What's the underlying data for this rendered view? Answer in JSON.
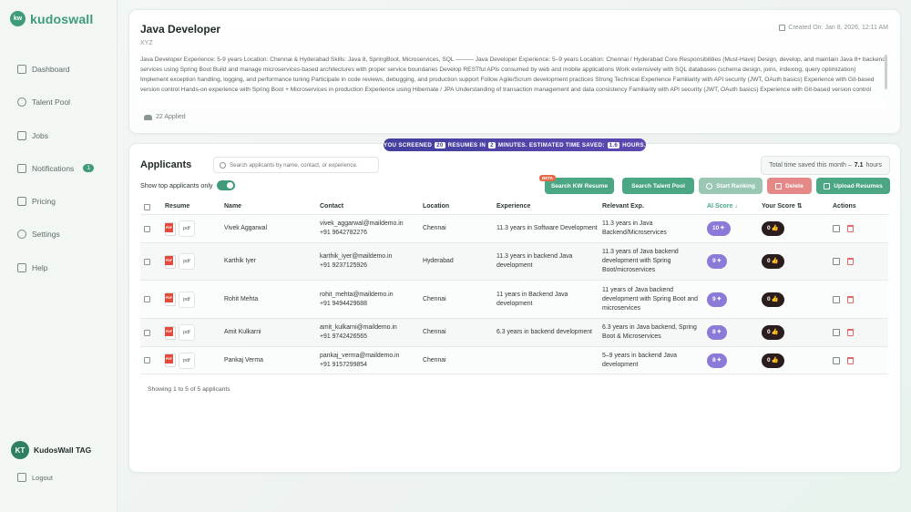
{
  "brand": {
    "mark": "kw",
    "name": "kudoswall"
  },
  "sidebar": {
    "items": [
      {
        "label": "Dashboard",
        "icon": "dashboard-icon"
      },
      {
        "label": "Talent Pool",
        "icon": "talent-pool-icon"
      },
      {
        "label": "Jobs",
        "icon": "jobs-icon"
      },
      {
        "label": "Notifications",
        "icon": "bell-icon",
        "badge": "1"
      },
      {
        "label": "Pricing",
        "icon": "pricing-icon"
      },
      {
        "label": "Settings",
        "icon": "gear-icon"
      },
      {
        "label": "Help",
        "icon": "help-icon"
      }
    ],
    "user": {
      "initials": "KT",
      "name": "KudosWall TAG"
    },
    "logout": "Logout"
  },
  "job": {
    "title": "Java Developer",
    "company": "XYZ",
    "created": "Created On: Jan 8, 2026, 12:11 AM",
    "description": "Java Developer Experience: 5-9 years Location: Chennai & Hyderabad Skills: Java 8, SpringBoot, Microservices, SQL ——— Java Developer Experience: 5–9 years Location: Chennai / Hyderabad Core Responsibilities (Must-Have) Design, develop, and maintain Java 8+ backend services using Spring Boot Build and manage microservices-based architectures with proper service boundaries Develop RESTful APIs consumed by web and mobile applications Work extensively with SQL databases (schema design, joins, indexing, query optimization) Implement exception handling, logging, and performance tuning Participate in code reviews, debugging, and production support Follow Agile/Scrum development practices Strong Technical Experience Familiarity with API security (JWT, OAuth basics) Experience with Git-based version control Hands-on experience with Spring Boot + Microservices in production Experience using Hibernate / JPA Understanding of transaction management and data consistency Familiarity with API security (JWT, OAuth basics) Experience with Git-based version control",
    "applied": "22 Applied"
  },
  "banner": {
    "prefix": "YOU SCREENED",
    "resumes": "20",
    "mid": "RESUMES IN",
    "minutes": "2",
    "mid2": "MINUTES. ESTIMATED TIME SAVED:",
    "hours": "1.6",
    "suffix": "HOURS."
  },
  "applicants": {
    "title": "Applicants",
    "search_placeholder": "Search applicants by name, contact, or experience.",
    "time_saved_label": "Total time saved this month –",
    "time_saved_value": "7.1",
    "time_saved_unit": "hours",
    "toggle_label": "Show top applicants only",
    "buttons": {
      "beta": "BETA",
      "kw": "Search KW Resume",
      "talent": "Search Talent Pool",
      "rank": "Start Ranking",
      "delete": "Delete",
      "upload": "Upload Resumes"
    },
    "columns": [
      "Resume",
      "Name",
      "Contact",
      "Location",
      "Experience",
      "Relevant Exp.",
      "AI Score",
      "Your Score",
      "Actions"
    ],
    "sort_down": "↓",
    "sort_both": "⇅",
    "rows": [
      {
        "resume": "pdf",
        "name": "Vivek Aggarwal",
        "email": "vivek_aggarwal@maildemo.in",
        "phone": "+91 9642782276",
        "location": "Chennai",
        "experience": "11.3 years in Software Development",
        "relevant": "11.3 years in Java Backend/Microservices",
        "ai": "10",
        "your": "0"
      },
      {
        "resume": "pdf",
        "name": "Karthik Iyer",
        "email": "karthik_iyer@maildemo.in",
        "phone": "+91 9237125926",
        "location": "Hyderabad",
        "experience": "11.3 years in backend Java development",
        "relevant": "11.3 years of Java backend development with Spring Boot/microservices",
        "ai": "9",
        "your": "0"
      },
      {
        "resume": "pdf",
        "name": "Rohit Mehta",
        "email": "rohit_mehta@maildemo.in",
        "phone": "+91 9494429688",
        "location": "Chennai",
        "experience": "11 years in Backend Java development",
        "relevant": "11 years of Java backend development with Spring Boot and microservices",
        "ai": "9",
        "your": "0"
      },
      {
        "resume": "pdf",
        "name": "Amit Kulkarni",
        "email": "amit_kulkarni@maildemo.in",
        "phone": "+91 9742426565",
        "location": "Chennai",
        "experience": "6.3 years in backend development",
        "relevant": "6.3 years in Java backend, Spring Boot & Microservices",
        "ai": "8",
        "your": "0"
      },
      {
        "resume": "pdf",
        "name": "Pankaj Verma",
        "email": "pankaj_verma@maildemo.in",
        "phone": "+91 9157299854",
        "location": "Chennai",
        "experience": "",
        "relevant": "5–9 years in backend Java development",
        "ai": "8",
        "your": "0"
      }
    ],
    "showing": "Showing 1 to 5 of 5 applicants"
  }
}
